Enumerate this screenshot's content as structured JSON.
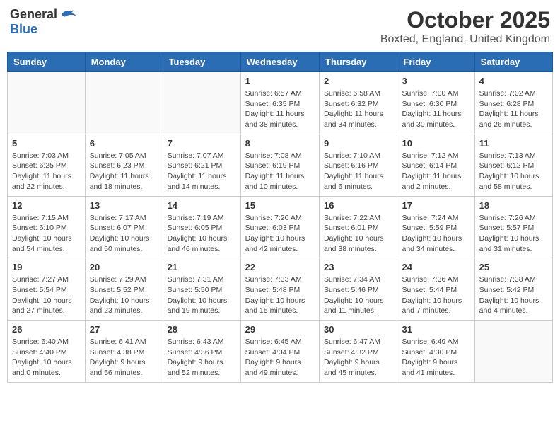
{
  "header": {
    "logo_general": "General",
    "logo_blue": "Blue",
    "month": "October 2025",
    "location": "Boxted, England, United Kingdom"
  },
  "days_of_week": [
    "Sunday",
    "Monday",
    "Tuesday",
    "Wednesday",
    "Thursday",
    "Friday",
    "Saturday"
  ],
  "weeks": [
    [
      {
        "day": "",
        "info": ""
      },
      {
        "day": "",
        "info": ""
      },
      {
        "day": "",
        "info": ""
      },
      {
        "day": "1",
        "info": "Sunrise: 6:57 AM\nSunset: 6:35 PM\nDaylight: 11 hours\nand 38 minutes."
      },
      {
        "day": "2",
        "info": "Sunrise: 6:58 AM\nSunset: 6:32 PM\nDaylight: 11 hours\nand 34 minutes."
      },
      {
        "day": "3",
        "info": "Sunrise: 7:00 AM\nSunset: 6:30 PM\nDaylight: 11 hours\nand 30 minutes."
      },
      {
        "day": "4",
        "info": "Sunrise: 7:02 AM\nSunset: 6:28 PM\nDaylight: 11 hours\nand 26 minutes."
      }
    ],
    [
      {
        "day": "5",
        "info": "Sunrise: 7:03 AM\nSunset: 6:25 PM\nDaylight: 11 hours\nand 22 minutes."
      },
      {
        "day": "6",
        "info": "Sunrise: 7:05 AM\nSunset: 6:23 PM\nDaylight: 11 hours\nand 18 minutes."
      },
      {
        "day": "7",
        "info": "Sunrise: 7:07 AM\nSunset: 6:21 PM\nDaylight: 11 hours\nand 14 minutes."
      },
      {
        "day": "8",
        "info": "Sunrise: 7:08 AM\nSunset: 6:19 PM\nDaylight: 11 hours\nand 10 minutes."
      },
      {
        "day": "9",
        "info": "Sunrise: 7:10 AM\nSunset: 6:16 PM\nDaylight: 11 hours\nand 6 minutes."
      },
      {
        "day": "10",
        "info": "Sunrise: 7:12 AM\nSunset: 6:14 PM\nDaylight: 11 hours\nand 2 minutes."
      },
      {
        "day": "11",
        "info": "Sunrise: 7:13 AM\nSunset: 6:12 PM\nDaylight: 10 hours\nand 58 minutes."
      }
    ],
    [
      {
        "day": "12",
        "info": "Sunrise: 7:15 AM\nSunset: 6:10 PM\nDaylight: 10 hours\nand 54 minutes."
      },
      {
        "day": "13",
        "info": "Sunrise: 7:17 AM\nSunset: 6:07 PM\nDaylight: 10 hours\nand 50 minutes."
      },
      {
        "day": "14",
        "info": "Sunrise: 7:19 AM\nSunset: 6:05 PM\nDaylight: 10 hours\nand 46 minutes."
      },
      {
        "day": "15",
        "info": "Sunrise: 7:20 AM\nSunset: 6:03 PM\nDaylight: 10 hours\nand 42 minutes."
      },
      {
        "day": "16",
        "info": "Sunrise: 7:22 AM\nSunset: 6:01 PM\nDaylight: 10 hours\nand 38 minutes."
      },
      {
        "day": "17",
        "info": "Sunrise: 7:24 AM\nSunset: 5:59 PM\nDaylight: 10 hours\nand 34 minutes."
      },
      {
        "day": "18",
        "info": "Sunrise: 7:26 AM\nSunset: 5:57 PM\nDaylight: 10 hours\nand 31 minutes."
      }
    ],
    [
      {
        "day": "19",
        "info": "Sunrise: 7:27 AM\nSunset: 5:54 PM\nDaylight: 10 hours\nand 27 minutes."
      },
      {
        "day": "20",
        "info": "Sunrise: 7:29 AM\nSunset: 5:52 PM\nDaylight: 10 hours\nand 23 minutes."
      },
      {
        "day": "21",
        "info": "Sunrise: 7:31 AM\nSunset: 5:50 PM\nDaylight: 10 hours\nand 19 minutes."
      },
      {
        "day": "22",
        "info": "Sunrise: 7:33 AM\nSunset: 5:48 PM\nDaylight: 10 hours\nand 15 minutes."
      },
      {
        "day": "23",
        "info": "Sunrise: 7:34 AM\nSunset: 5:46 PM\nDaylight: 10 hours\nand 11 minutes."
      },
      {
        "day": "24",
        "info": "Sunrise: 7:36 AM\nSunset: 5:44 PM\nDaylight: 10 hours\nand 7 minutes."
      },
      {
        "day": "25",
        "info": "Sunrise: 7:38 AM\nSunset: 5:42 PM\nDaylight: 10 hours\nand 4 minutes."
      }
    ],
    [
      {
        "day": "26",
        "info": "Sunrise: 6:40 AM\nSunset: 4:40 PM\nDaylight: 10 hours\nand 0 minutes."
      },
      {
        "day": "27",
        "info": "Sunrise: 6:41 AM\nSunset: 4:38 PM\nDaylight: 9 hours\nand 56 minutes."
      },
      {
        "day": "28",
        "info": "Sunrise: 6:43 AM\nSunset: 4:36 PM\nDaylight: 9 hours\nand 52 minutes."
      },
      {
        "day": "29",
        "info": "Sunrise: 6:45 AM\nSunset: 4:34 PM\nDaylight: 9 hours\nand 49 minutes."
      },
      {
        "day": "30",
        "info": "Sunrise: 6:47 AM\nSunset: 4:32 PM\nDaylight: 9 hours\nand 45 minutes."
      },
      {
        "day": "31",
        "info": "Sunrise: 6:49 AM\nSunset: 4:30 PM\nDaylight: 9 hours\nand 41 minutes."
      },
      {
        "day": "",
        "info": ""
      }
    ]
  ]
}
